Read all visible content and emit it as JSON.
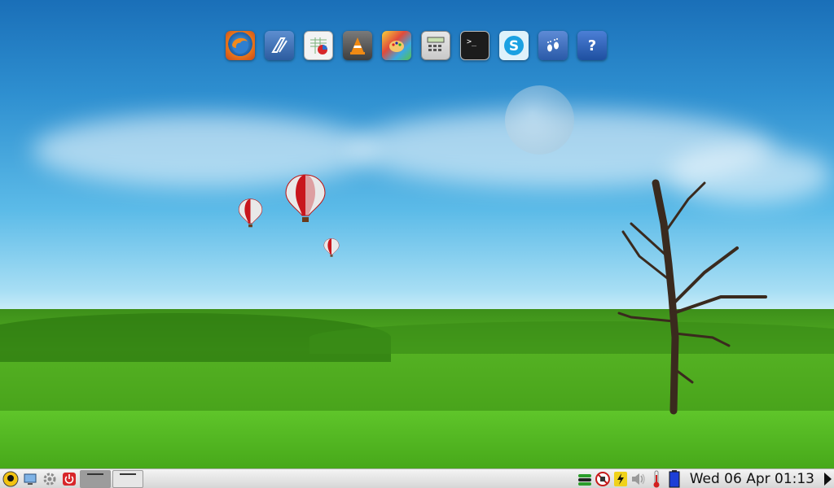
{
  "dock": {
    "items": [
      {
        "name": "firefox-icon",
        "label": "Firefox"
      },
      {
        "name": "drawing-icon",
        "label": "Drawing"
      },
      {
        "name": "spreadsheet-icon",
        "label": "Spreadsheet"
      },
      {
        "name": "vlc-icon",
        "label": "VLC"
      },
      {
        "name": "paint-icon",
        "label": "Paint"
      },
      {
        "name": "calculator-icon",
        "label": "Calculator"
      },
      {
        "name": "terminal-icon",
        "label": "Terminal"
      },
      {
        "name": "skype-icon",
        "label": "Skype"
      },
      {
        "name": "footprints-icon",
        "label": "Footprints"
      },
      {
        "name": "help-icon",
        "label": "Help"
      }
    ]
  },
  "taskbar": {
    "clock": "Wed 06 Apr 01:13",
    "start_icon": "start-menu-icon",
    "show_desktop_icon": "show-desktop-icon",
    "settings_icon": "gear-icon",
    "power_icon": "power-icon",
    "tray_icons": [
      "network-icon",
      "no-connection-icon",
      "battery-charging-icon",
      "volume-icon",
      "thermometer-icon",
      "battery-level-icon"
    ]
  },
  "colors": {
    "taskbar_bg": "#dcdcdc",
    "sky_top": "#1a6fb8",
    "grass": "#4aa51c"
  }
}
